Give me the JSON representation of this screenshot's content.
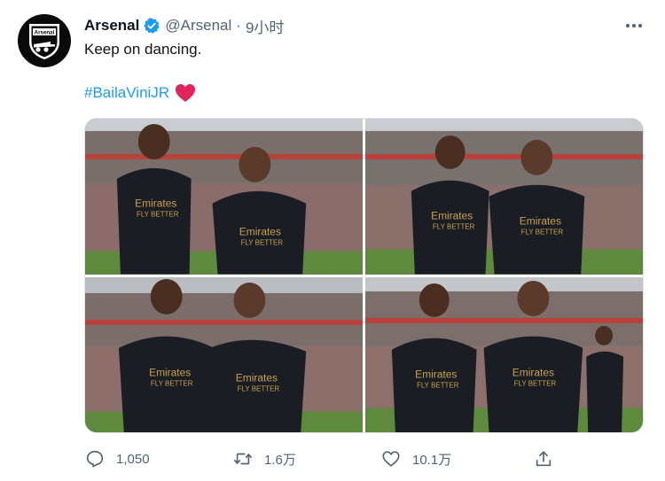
{
  "tweet": {
    "author_name": "Arsenal",
    "handle": "@Arsenal",
    "time": "9小时",
    "avatar_text": "Arsenal",
    "text": "Keep on dancing.",
    "hashtag": "#BailaViniJR",
    "hashtag_emoji": "heart-icon",
    "verified_icon": "verified-badge-icon"
  },
  "media": {
    "photos": [
      {
        "id": "photo-1"
      },
      {
        "id": "photo-2"
      },
      {
        "id": "photo-3"
      },
      {
        "id": "photo-4"
      }
    ],
    "jersey_sponsor": "Emirates",
    "jersey_sponsor_sub": "FLY BETTER"
  },
  "actions": {
    "reply_count": "1,050",
    "retweet_count": "1.6万",
    "like_count": "10.1万",
    "reply_icon": "reply-icon",
    "retweet_icon": "retweet-icon",
    "like_icon": "like-icon",
    "share_icon": "share-icon"
  },
  "colors": {
    "accent": "#1d9bf0",
    "text_secondary": "#536471",
    "heart": "#e0245e",
    "jersey": "#1a1d24",
    "sponsor_gold": "#c9a24b"
  }
}
